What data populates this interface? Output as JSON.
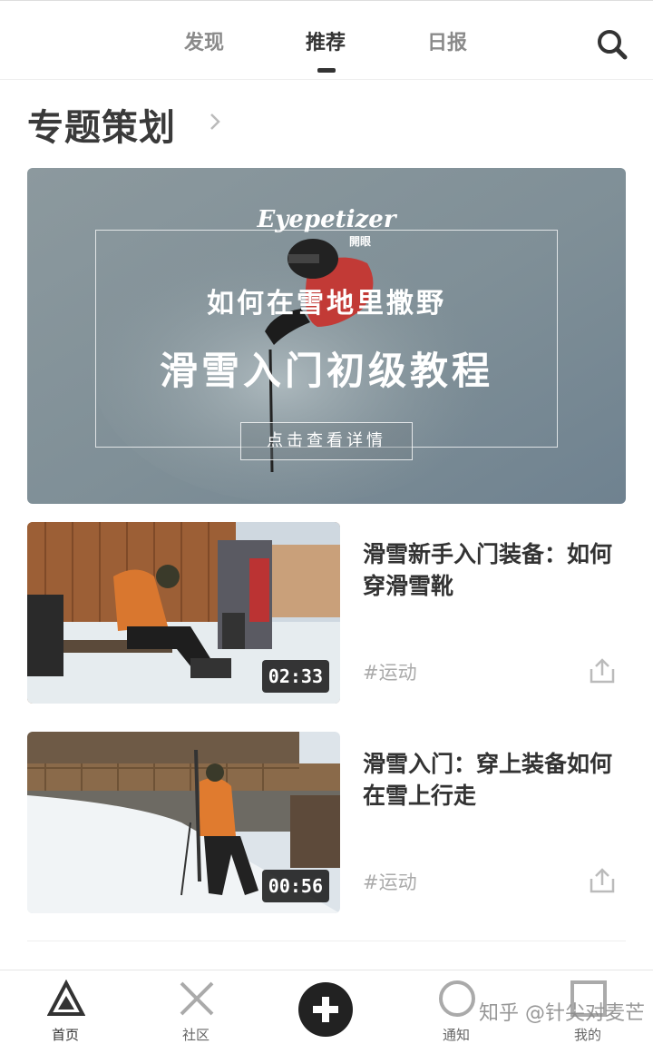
{
  "top_nav": {
    "tabs": [
      {
        "label": "发现"
      },
      {
        "label": "推荐",
        "active": true
      },
      {
        "label": "日报"
      }
    ],
    "search_icon": "search-icon"
  },
  "section": {
    "title": "专题策划",
    "arrow_icon": "chevron-right-icon"
  },
  "banner": {
    "logo": "Eyepetizer",
    "logo_sub": "開眼",
    "subtitle": "如何在雪地里撒野",
    "title": "滑雪入门初级教程",
    "button": "点击查看详情"
  },
  "videos": [
    {
      "title": "滑雪新手入门装备：如何穿滑雪靴",
      "duration": "02:33",
      "tag": "#运动"
    },
    {
      "title": "滑雪入门：穿上装备如何在雪上行走",
      "duration": "00:56",
      "tag": "#运动"
    }
  ],
  "bottom_nav": {
    "items": [
      {
        "label": "首页",
        "icon": "triangle-home-icon"
      },
      {
        "label": "社区",
        "icon": "cross-community-icon"
      },
      {
        "label": "",
        "icon": "plus-icon"
      },
      {
        "label": "通知",
        "icon": "circle-notification-icon"
      },
      {
        "label": "我的",
        "icon": "square-profile-icon"
      }
    ]
  },
  "watermark": "知乎 @针尖对麦芒"
}
